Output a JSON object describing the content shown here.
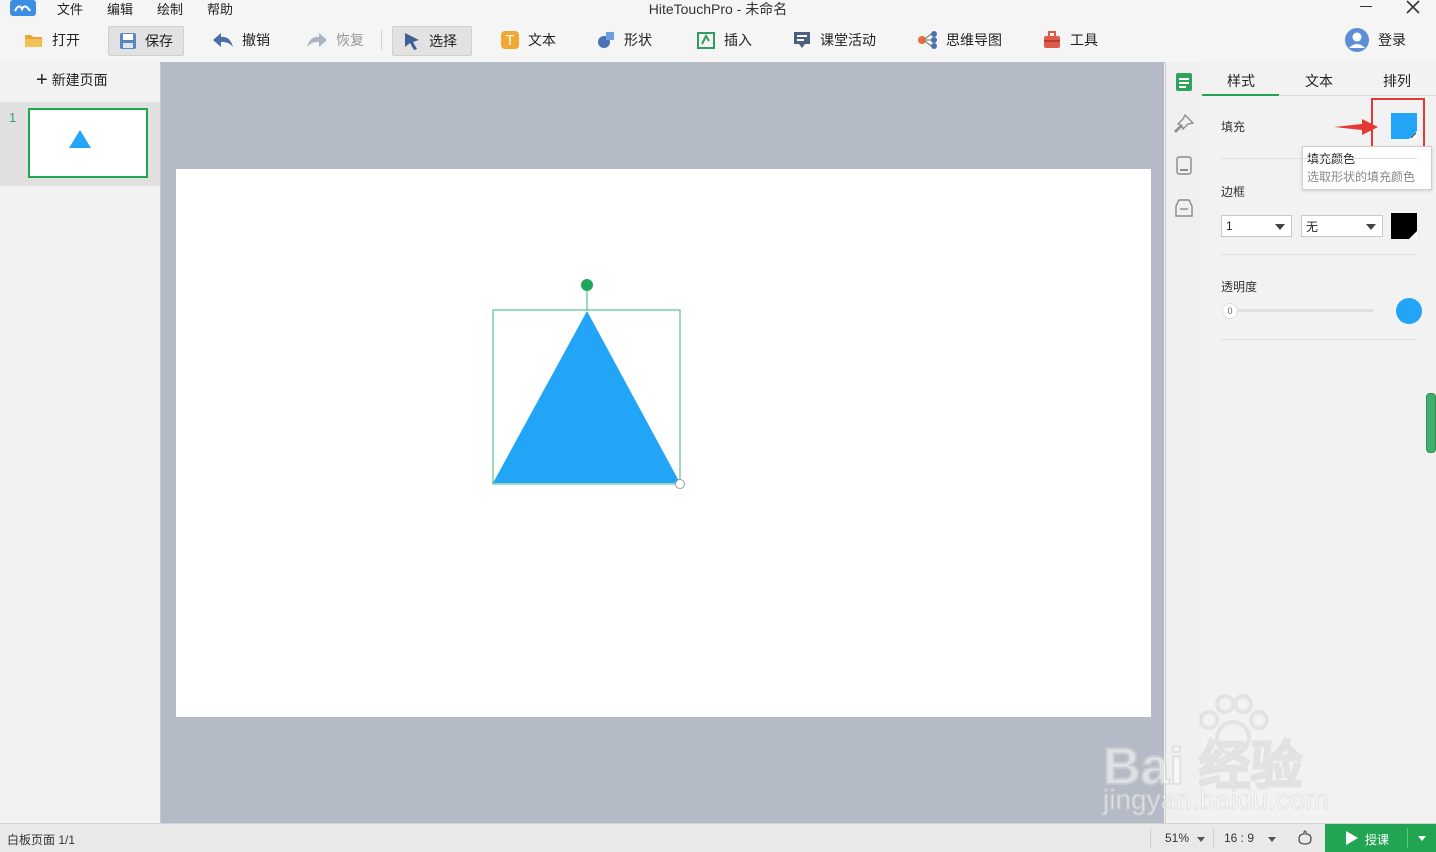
{
  "app": {
    "title": "HiteTouchPro - 未命名",
    "menu": [
      "文件",
      "编辑",
      "绘制",
      "帮助"
    ]
  },
  "toolbar": {
    "open": "打开",
    "save": "保存",
    "undo": "撤销",
    "redo": "恢复",
    "select": "选择",
    "text": "文本",
    "shape": "形状",
    "insert": "插入",
    "class_activity": "课堂活动",
    "mind_map": "思维导图",
    "tools": "工具",
    "login": "登录"
  },
  "pages": {
    "new_page": "新建页面",
    "items": [
      {
        "number": "1"
      }
    ]
  },
  "shape": {
    "type": "triangle",
    "fill_color": "#22a4f7",
    "selection_color": "#3cb371"
  },
  "right_panel": {
    "tabs": [
      "样式",
      "文本",
      "排列"
    ],
    "fill_label": "填充",
    "fill_color": "#22a4f7",
    "tooltip_title": "填充颜色",
    "tooltip_desc": "选取形状的填充颜色",
    "border_label": "边框",
    "border_width": "1",
    "border_style": "无",
    "border_color": "#000000",
    "opacity_label": "透明度",
    "opacity_value": "0"
  },
  "status": {
    "page_info": "白板页面 1/1",
    "zoom": "51%",
    "ratio": "16 : 9",
    "teach": "授课"
  },
  "watermark": {
    "line1": "Bai 经验",
    "line2": "jingyan.baidu.com"
  }
}
